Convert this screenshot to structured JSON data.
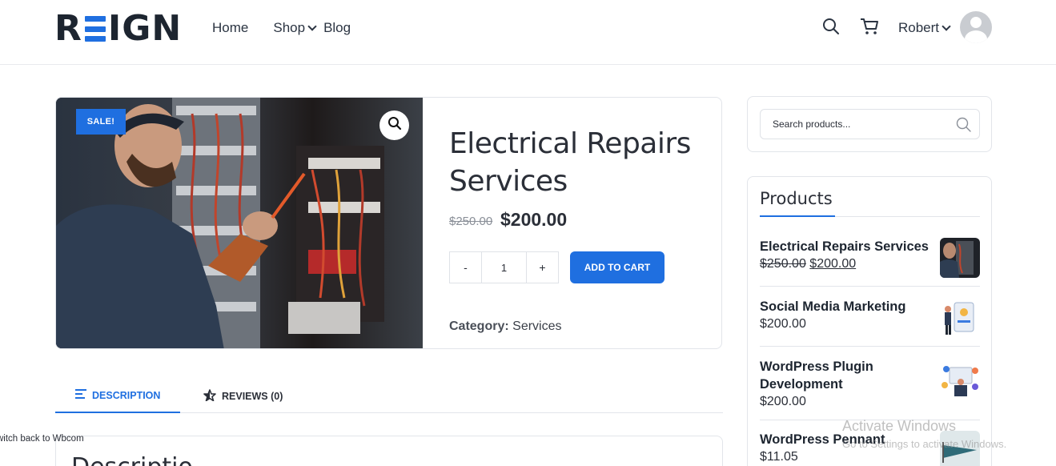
{
  "header": {
    "logo_text": "REIGN",
    "nav": [
      {
        "label": "Home"
      },
      {
        "label": "Shop"
      },
      {
        "label": "Blog"
      }
    ],
    "user_name": "Robert"
  },
  "product": {
    "badge": "SALE!",
    "title": "Electrical Repairs Services",
    "price_old": "$250.00",
    "price_new": "$200.00",
    "qty_minus": "-",
    "quantity": "1",
    "qty_plus": "+",
    "add_to_cart": "ADD TO CART",
    "category_label": "Category:",
    "category_value": "Services"
  },
  "tabs": [
    {
      "label": "DESCRIPTION"
    },
    {
      "label": "REVIEWS (0)"
    }
  ],
  "description_heading": "Descriptio",
  "switch_back": "witch back to Wbcom",
  "sidebar": {
    "search_placeholder": "Search products...",
    "products_title": "Products",
    "products": [
      {
        "name": "Electrical Repairs Services",
        "price_old": "$250.00",
        "price": "$200.00"
      },
      {
        "name": "Social Media Marketing",
        "price": "$200.00"
      },
      {
        "name": "WordPress Plugin Development",
        "price": "$200.00"
      },
      {
        "name": "WordPress Pennant",
        "price": "$11.05"
      }
    ]
  },
  "watermark": {
    "line1": "Activate Windows",
    "line2": "Go to Settings to activate Windows."
  },
  "colors": {
    "accent": "#1f6fe0",
    "text": "#2b2f38"
  }
}
